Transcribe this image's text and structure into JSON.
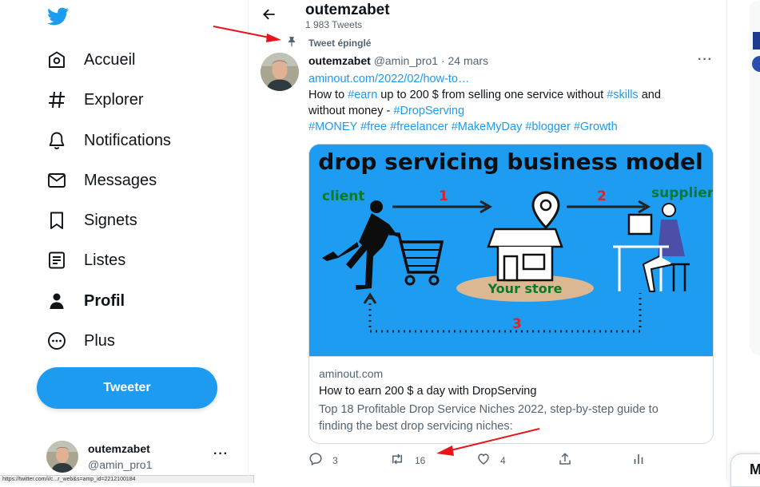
{
  "sidebar": {
    "items": [
      {
        "label": "Accueil",
        "icon": "home-icon"
      },
      {
        "label": "Explorer",
        "icon": "hashtag-icon"
      },
      {
        "label": "Notifications",
        "icon": "bell-icon"
      },
      {
        "label": "Messages",
        "icon": "envelope-icon"
      },
      {
        "label": "Signets",
        "icon": "bookmark-icon"
      },
      {
        "label": "Listes",
        "icon": "list-icon"
      },
      {
        "label": "Profil",
        "icon": "person-icon"
      },
      {
        "label": "Plus",
        "icon": "more-circle-icon"
      }
    ],
    "tweet_button": "Tweeter",
    "account": {
      "name": "outemzabet",
      "handle": "@amin_pro1",
      "more": "···"
    }
  },
  "status_url": "https://twitter.com/i/c...r_web&s=amp_id=2212100184",
  "header": {
    "name": "outemzabet",
    "count": "1 983 Tweets"
  },
  "tweet": {
    "pinned_label": "Tweet épinglé",
    "author_name": "outemzabet",
    "author_handle": "@amin_pro1",
    "separator": " · ",
    "date": "24 mars",
    "more": "···",
    "link": "aminout.com/2022/02/how-to…",
    "text_1": " How to ",
    "tag_earn": "#earn",
    "text_2": " up to 200 $ from selling one service without ",
    "tag_skills": "#skills",
    "text_3": " and without money - ",
    "tag_dropserving": "#DropServing",
    "tags_line": [
      "#MONEY",
      "#free",
      "#freelancer",
      "#MakeMyDay",
      "#blogger",
      "#Growth"
    ],
    "image": {
      "title": "drop servicing business model",
      "client": "client",
      "supplier": "supplier",
      "store": "Your store",
      "step1": "1",
      "step2": "2",
      "step3": "3"
    },
    "card": {
      "domain": "aminout.com",
      "title": "How to earn 200 $ a day with DropServing",
      "description": "Top 18 Profitable Drop Service Niches 2022, step-by-step guide to finding the best drop servicing niches:"
    },
    "actions": {
      "replies": "3",
      "retweets": "16",
      "likes": "4"
    }
  },
  "right_panel": {
    "partial_letter": "M"
  },
  "colors": {
    "accent": "#1d9bf0",
    "annotation_arrow": "#e8141b",
    "image_bg": "#1e9cf2"
  }
}
